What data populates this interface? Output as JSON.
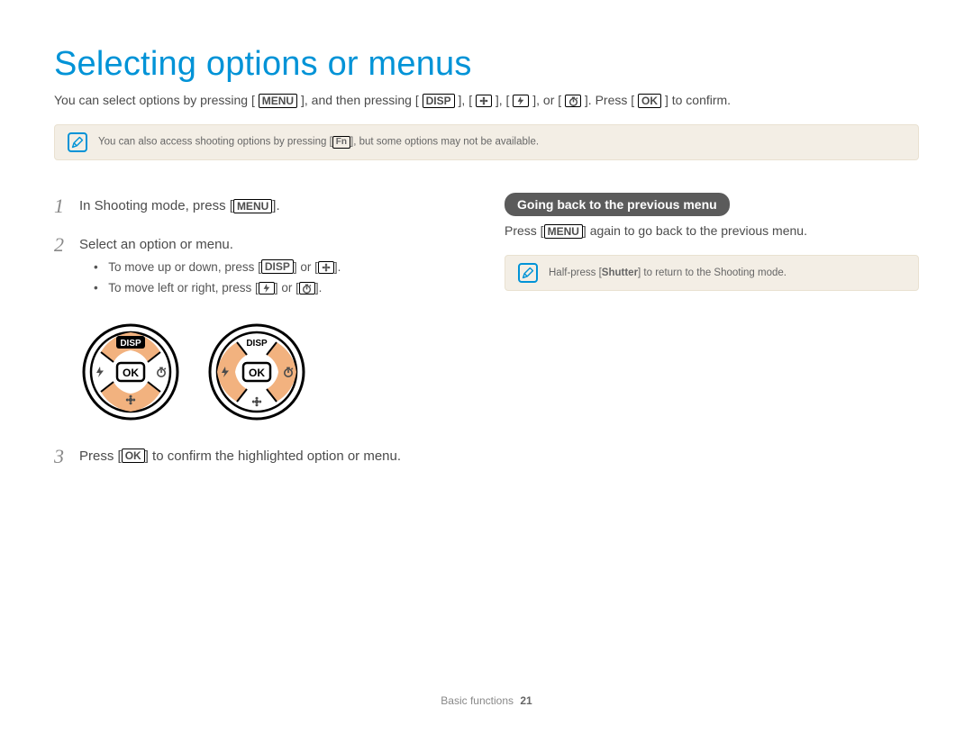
{
  "title": "Selecting options or menus",
  "intro": {
    "p1": "You can select options by pressing [",
    "p2": "], and then pressing [",
    "p3": "], [",
    "p4": "], [",
    "p5": "], or [",
    "p6": "]. Press [",
    "p7": "] to confirm."
  },
  "buttons": {
    "menu": "MENU",
    "disp": "DISP",
    "ok": "OK",
    "fn": "Fn",
    "shutter": "Shutter"
  },
  "note1": {
    "pre": "You can also access shooting options by pressing [",
    "post": "], but some options may not be available."
  },
  "steps": {
    "s1": {
      "num": "1",
      "text_pre": "In Shooting mode, press [",
      "text_post": "]."
    },
    "s2": {
      "num": "2",
      "text": "Select an option or menu.",
      "bullet1_pre": "To move up or down, press [",
      "bullet1_mid": "] or [",
      "bullet1_post": "].",
      "bullet2_pre": "To move left or right, press [",
      "bullet2_mid": "] or [",
      "bullet2_post": "]."
    },
    "s3": {
      "num": "3",
      "text_pre": "Press [",
      "text_post": "] to confirm the highlighted option or menu."
    }
  },
  "goback": {
    "heading": "Going back to the previous menu",
    "text_pre": "Press [",
    "text_post": "] again to go back to the previous menu."
  },
  "note2": {
    "pre": "Half-press [",
    "post": "] to return to the Shooting mode."
  },
  "footer": {
    "section": "Basic functions",
    "page": "21"
  }
}
